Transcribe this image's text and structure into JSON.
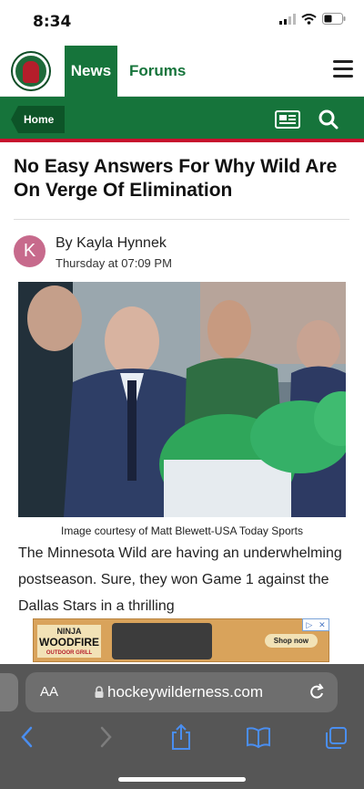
{
  "status": {
    "time": "8:34"
  },
  "nav": {
    "news": "News",
    "forums": "Forums"
  },
  "breadcrumb": {
    "home": "Home"
  },
  "article": {
    "title": "No Easy Answers For Why Wild Are On Verge Of Elimination",
    "avatar_letter": "K",
    "author": "By Kayla Hynnek",
    "date": "Thursday at 07:09 PM",
    "caption": "Image courtesy of Matt Blewett-USA Today Sports",
    "body": "The Minnesota Wild are having an underwhelming postseason. Sure, they won Game 1 against the Dallas Stars in a thrilling"
  },
  "ad": {
    "brand_top": "NINJA",
    "brand_name": "WOODFIRE",
    "brand_sub": "OUTDOOR GRILL",
    "cta": "Shop now"
  },
  "browser": {
    "text_size": "AA",
    "url": "hockeywilderness.com"
  },
  "colors": {
    "brand_green": "#16743b",
    "accent_red": "#c8102e"
  }
}
